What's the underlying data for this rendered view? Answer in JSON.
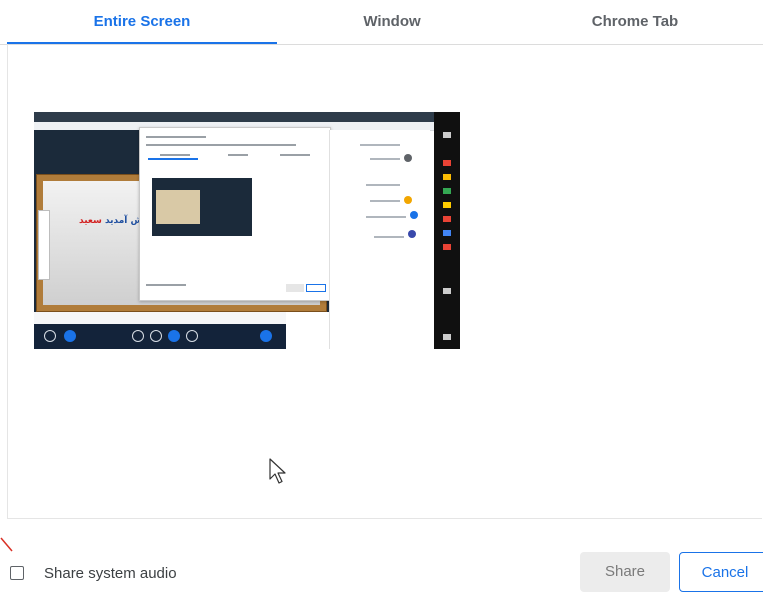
{
  "tabs": [
    {
      "label": "Entire Screen",
      "active": true
    },
    {
      "label": "Window",
      "active": false
    },
    {
      "label": "Chrome Tab",
      "active": false
    }
  ],
  "preview": {
    "board_text_red": "سعید",
    "board_text_blue": "خوش آمدید"
  },
  "audio": {
    "label": "Share system audio",
    "checked": false
  },
  "buttons": {
    "share_label": "Share",
    "cancel_label": "Cancel"
  },
  "colors": {
    "accent": "#1a73e8",
    "tab_inactive": "#5f6368",
    "share_bg": "#ececec"
  }
}
